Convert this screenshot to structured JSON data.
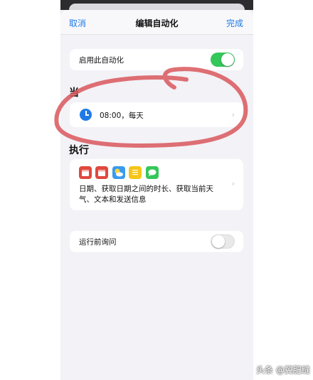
{
  "navbar": {
    "cancel": "取消",
    "title": "编辑自动化",
    "done": "完成"
  },
  "enable_row": {
    "label": "启用此自动化",
    "toggle_on": true
  },
  "when_section": {
    "title": "当",
    "trigger_text": "08:00，每天",
    "icon": "clock-icon"
  },
  "do_section": {
    "title": "执行",
    "icons": [
      "calendar-icon",
      "calendar-icon",
      "weather-icon",
      "notes-icon",
      "messages-icon"
    ],
    "description": "日期、获取日期之间的时长、获取当前天气、文本和发送信息"
  },
  "ask_row": {
    "label": "运行前询问",
    "toggle_on": false
  },
  "watermark": "头条 @翼肥缝",
  "colors": {
    "accent": "#1f7ae8",
    "toggle_on": "#34c759",
    "annotation": "#d9575c"
  }
}
